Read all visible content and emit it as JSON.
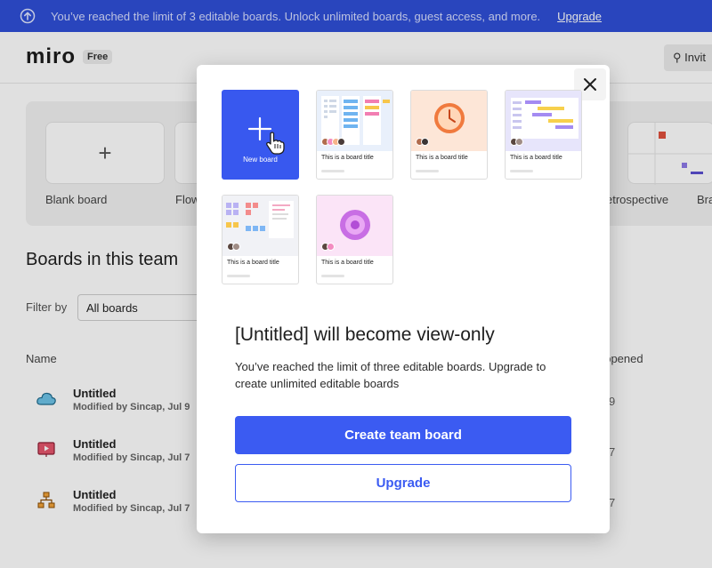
{
  "banner": {
    "text": "You’ve reached the limit of 3 editable boards. Unlock unlimited boards, guest access, and more.",
    "upgrade_link": "Upgrade"
  },
  "header": {
    "logo": "miro",
    "plan_badge": "Free",
    "invite_label": "Invit"
  },
  "templates": {
    "blank_label": "Blank board",
    "flow_label": "Flow",
    "retro_label": "etrospective",
    "brainstorm_label": "Bra"
  },
  "boards": {
    "title": "Boards in this team",
    "filter_label": "Filter by",
    "filter_value": "All boards",
    "col_name": "Name",
    "col_opened": "t opened",
    "rows": [
      {
        "title": "Untitled",
        "meta": "Modified by Sincap, Jul 9",
        "opened": "9"
      },
      {
        "title": "Untitled",
        "meta": "Modified by Sincap, Jul 7",
        "opened": "7"
      },
      {
        "title": "Untitled",
        "meta": "Modified by Sincap, Jul 7",
        "opened": "7"
      }
    ]
  },
  "modal": {
    "new_board_label": "New board",
    "tile_title": "This is a board title",
    "heading": "[Untitled] will become view-only",
    "body": "You’ve reached the limit of three editable boards. Upgrade to create unlimited editable boards",
    "primary_button": "Create team board",
    "secondary_button": "Upgrade"
  },
  "colors": {
    "banner_bg": "#2f4fd8",
    "primary": "#3b5bf2"
  }
}
